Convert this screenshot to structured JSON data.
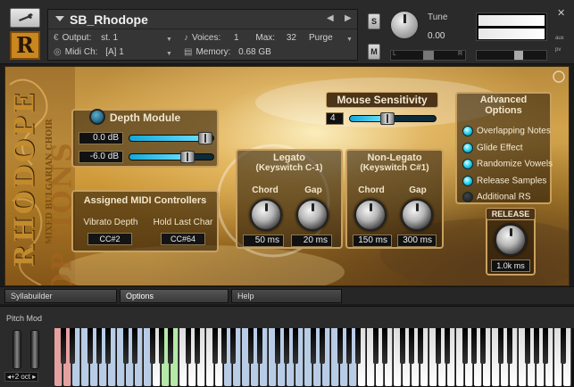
{
  "header": {
    "instrument_name": "SB_Rhodope",
    "output_label": "Output:",
    "output_value": "st. 1",
    "voices_label": "Voices:",
    "voices_value": "1",
    "max_label": "Max:",
    "max_value": "32",
    "purge_label": "Purge",
    "midi_label": "Midi Ch:",
    "midi_value": "[A] 1",
    "memory_label": "Memory:",
    "memory_value": "0.68 GB",
    "solo_label": "S",
    "mute_label": "M",
    "tune_label": "Tune",
    "tune_value": "0.00",
    "pan_left": "L",
    "pan_right": "R",
    "close_label": "✕",
    "aux_label": "aux",
    "pv_label": "pv"
  },
  "side": {
    "title": "RHODOPE",
    "subtitle": "MIXED BULGARIAN CHOIR",
    "options": "OPTIONS"
  },
  "depth_module": {
    "title": "Depth Module",
    "value1": "0.0 dB",
    "value2": "-6.0 dB",
    "slider1_level": 0.93,
    "slider2_level": 0.72
  },
  "assigned_midi": {
    "title": "Assigned MIDI Controllers",
    "vibrato_label": "Vibrato Depth",
    "vibrato_cc": "CC#2",
    "hold_label": "Hold Last Char",
    "hold_cc": "CC#64"
  },
  "legato": {
    "title_line1": "Legato",
    "title_line2": "(Keyswitch C-1)",
    "chord_label": "Chord",
    "gap_label": "Gap",
    "chord_value": "50 ms",
    "gap_value": "20 ms"
  },
  "non_legato": {
    "title_line1": "Non-Legato",
    "title_line2": "(Keyswitch C#1)",
    "chord_label": "Chord",
    "gap_label": "Gap",
    "chord_value": "150 ms",
    "gap_value": "300 ms"
  },
  "mouse_sensitivity": {
    "title": "Mouse Sensitivity",
    "value": "4",
    "level": 0.4
  },
  "advanced_options": {
    "title_line1": "Advanced",
    "title_line2": "Options",
    "items": [
      {
        "label": "Overlapping Notes",
        "on": true
      },
      {
        "label": "Glide Effect",
        "on": true
      },
      {
        "label": "Randomize Vowels",
        "on": true
      },
      {
        "label": "Release Samples",
        "on": true
      },
      {
        "label": "Additional RS",
        "on": false
      }
    ]
  },
  "release": {
    "title": "RELEASE",
    "value": "1.0k ms"
  },
  "tabs": [
    "Syllabuilder",
    "Options",
    "Help"
  ],
  "keyboard": {
    "pitch_mod_label": "Pitch Mod",
    "octave_label": "◂+2 oct ▸",
    "colors": {
      "keyswitch_red": "#e7a0a0",
      "keyswitch_green": "#b6e8a8",
      "range_blue": "#b8cce6"
    }
  }
}
